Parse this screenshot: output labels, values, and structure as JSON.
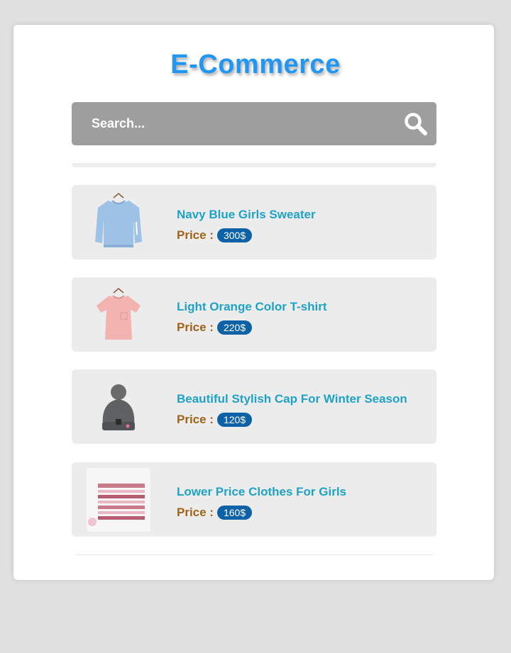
{
  "header": {
    "title": "E-Commerce"
  },
  "search": {
    "placeholder": "Search..."
  },
  "products": [
    {
      "name": "Navy Blue Girls Sweater",
      "price_label": "Price :",
      "price": "300$"
    },
    {
      "name": "Light Orange Color T-shirt",
      "price_label": "Price :",
      "price": "220$"
    },
    {
      "name": "Beautiful Stylish Cap For Winter Season",
      "price_label": "Price :",
      "price": "120$"
    },
    {
      "name": "Lower Price Clothes For Girls",
      "price_label": "Price :",
      "price": "160$"
    }
  ],
  "colors": {
    "page_background": "#e0e0e0",
    "title": "#2196f3",
    "search_bar": "#9e9e9e",
    "product_name": "#1ea2c7",
    "price_label": "#a0631a",
    "price_badge": "#0d61a6"
  },
  "icons": [
    "search-icon",
    "sweater-image",
    "tshirt-image",
    "cap-image",
    "striped-top-image"
  ]
}
